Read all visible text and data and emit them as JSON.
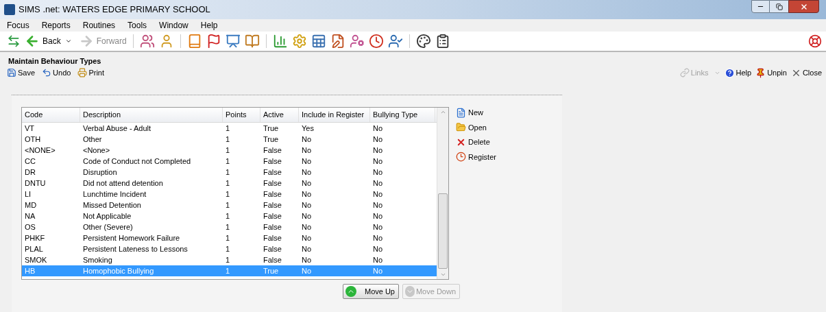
{
  "window": {
    "title": "SIMS .net: WATERS EDGE PRIMARY SCHOOL"
  },
  "menu": [
    "Focus",
    "Reports",
    "Routines",
    "Tools",
    "Window",
    "Help"
  ],
  "toolbar": {
    "back": {
      "label": "Back",
      "disabled": false
    },
    "forward": {
      "label": "Forward",
      "disabled": true
    }
  },
  "panel": {
    "title": "Maintain Behaviour Types",
    "actions": [
      {
        "kind": "save",
        "label": "Save"
      },
      {
        "kind": "undo",
        "label": "Undo"
      },
      {
        "kind": "print",
        "label": "Print"
      }
    ],
    "right_actions": [
      {
        "kind": "links",
        "label": "Links",
        "disabled": true
      },
      {
        "kind": "help",
        "label": "Help",
        "disabled": false
      },
      {
        "kind": "unpin",
        "label": "Unpin",
        "disabled": false
      },
      {
        "kind": "close",
        "label": "Close",
        "disabled": false
      }
    ]
  },
  "table": {
    "columns": [
      "Code",
      "Description",
      "Points",
      "Active",
      "Include in Register",
      "Bullying Type"
    ],
    "rows": [
      {
        "cells": [
          "VT",
          "Verbal Abuse - Adult",
          "1",
          "True",
          "Yes",
          "No"
        ],
        "selected": false
      },
      {
        "cells": [
          "OTH",
          "Other",
          "1",
          "True",
          "No",
          "No"
        ],
        "selected": false
      },
      {
        "cells": [
          "<NONE>",
          "<None>",
          "1",
          "False",
          "No",
          "No"
        ],
        "selected": false
      },
      {
        "cells": [
          "CC",
          "Code of Conduct not Completed",
          "1",
          "False",
          "No",
          "No"
        ],
        "selected": false
      },
      {
        "cells": [
          "DR",
          "Disruption",
          "1",
          "False",
          "No",
          "No"
        ],
        "selected": false
      },
      {
        "cells": [
          "DNTU",
          "Did not attend detention",
          "1",
          "False",
          "No",
          "No"
        ],
        "selected": false
      },
      {
        "cells": [
          "LI",
          "Lunchtime Incident",
          "1",
          "False",
          "No",
          "No"
        ],
        "selected": false
      },
      {
        "cells": [
          "MD",
          "Missed Detention",
          "1",
          "False",
          "No",
          "No"
        ],
        "selected": false
      },
      {
        "cells": [
          "NA",
          "Not Applicable",
          "1",
          "False",
          "No",
          "No"
        ],
        "selected": false
      },
      {
        "cells": [
          "OS",
          "Other (Severe)",
          "1",
          "False",
          "No",
          "No"
        ],
        "selected": false
      },
      {
        "cells": [
          "PHKF",
          "Persistent Homework Failure",
          "1",
          "False",
          "No",
          "No"
        ],
        "selected": false
      },
      {
        "cells": [
          "PLAL",
          "Persistent Lateness to Lessons",
          "1",
          "False",
          "No",
          "No"
        ],
        "selected": false
      },
      {
        "cells": [
          "SMOK",
          "Smoking",
          "1",
          "False",
          "No",
          "No"
        ],
        "selected": false
      },
      {
        "cells": [
          "HB",
          "Homophobic Bullying",
          "1",
          "True",
          "No",
          "No"
        ],
        "selected": true
      }
    ]
  },
  "side_actions": [
    {
      "kind": "new",
      "label": "New"
    },
    {
      "kind": "open",
      "label": "Open"
    },
    {
      "kind": "delete",
      "label": "Delete"
    },
    {
      "kind": "register",
      "label": "Register"
    }
  ],
  "buttons": [
    {
      "kind": "up",
      "label": "Move Up",
      "disabled": false
    },
    {
      "kind": "down",
      "label": "Move Down",
      "disabled": true
    }
  ]
}
